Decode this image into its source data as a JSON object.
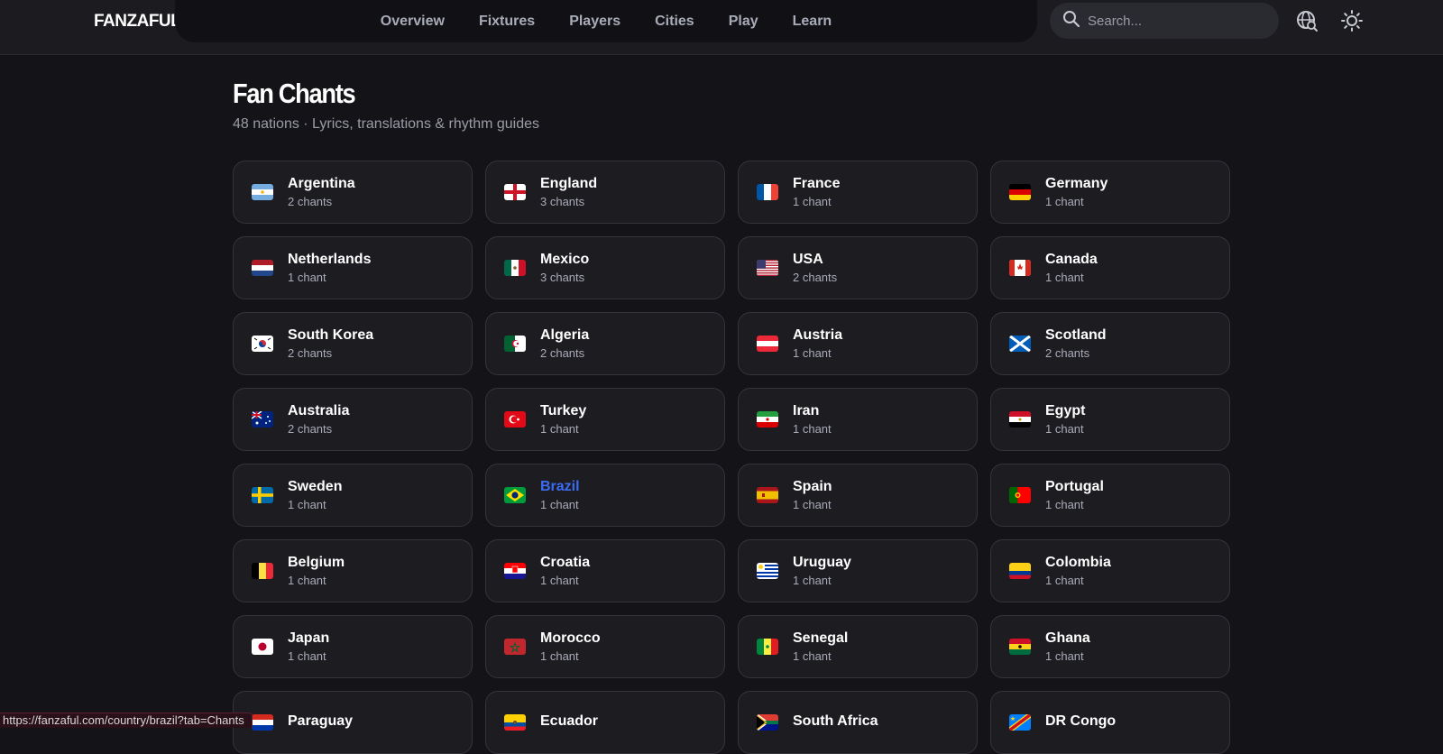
{
  "header": {
    "logo": "FANZAFUL",
    "nav": [
      "Overview",
      "Fixtures",
      "Players",
      "Cities",
      "Play",
      "Learn"
    ],
    "search_placeholder": "Search..."
  },
  "page": {
    "title": "Fan Chants",
    "subtitle": "48 nations · Lyrics, translations & rhythm guides"
  },
  "countries": [
    {
      "name": "Argentina",
      "count": "2 chants"
    },
    {
      "name": "England",
      "count": "3 chants"
    },
    {
      "name": "France",
      "count": "1 chant"
    },
    {
      "name": "Germany",
      "count": "1 chant"
    },
    {
      "name": "Netherlands",
      "count": "1 chant"
    },
    {
      "name": "Mexico",
      "count": "3 chants"
    },
    {
      "name": "USA",
      "count": "2 chants"
    },
    {
      "name": "Canada",
      "count": "1 chant"
    },
    {
      "name": "South Korea",
      "count": "2 chants"
    },
    {
      "name": "Algeria",
      "count": "2 chants"
    },
    {
      "name": "Austria",
      "count": "1 chant"
    },
    {
      "name": "Scotland",
      "count": "2 chants"
    },
    {
      "name": "Australia",
      "count": "2 chants"
    },
    {
      "name": "Turkey",
      "count": "1 chant"
    },
    {
      "name": "Iran",
      "count": "1 chant"
    },
    {
      "name": "Egypt",
      "count": "1 chant"
    },
    {
      "name": "Sweden",
      "count": "1 chant"
    },
    {
      "name": "Brazil",
      "count": "1 chant"
    },
    {
      "name": "Spain",
      "count": "1 chant"
    },
    {
      "name": "Portugal",
      "count": "1 chant"
    },
    {
      "name": "Belgium",
      "count": "1 chant"
    },
    {
      "name": "Croatia",
      "count": "1 chant"
    },
    {
      "name": "Uruguay",
      "count": "1 chant"
    },
    {
      "name": "Colombia",
      "count": "1 chant"
    },
    {
      "name": "Japan",
      "count": "1 chant"
    },
    {
      "name": "Morocco",
      "count": "1 chant"
    },
    {
      "name": "Senegal",
      "count": "1 chant"
    },
    {
      "name": "Ghana",
      "count": "1 chant"
    },
    {
      "name": "Paraguay",
      "count": ""
    },
    {
      "name": "Ecuador",
      "count": ""
    },
    {
      "name": "South Africa",
      "count": ""
    },
    {
      "name": "DR Congo",
      "count": ""
    }
  ],
  "status_url": "https://fanzaful.com/country/brazil?tab=Chants",
  "colors": {
    "background": "#131318",
    "card": "#1c1c21",
    "card_border": "#34343b",
    "hover_link": "#3b6cf6",
    "nav_text": "#a9acb8"
  }
}
